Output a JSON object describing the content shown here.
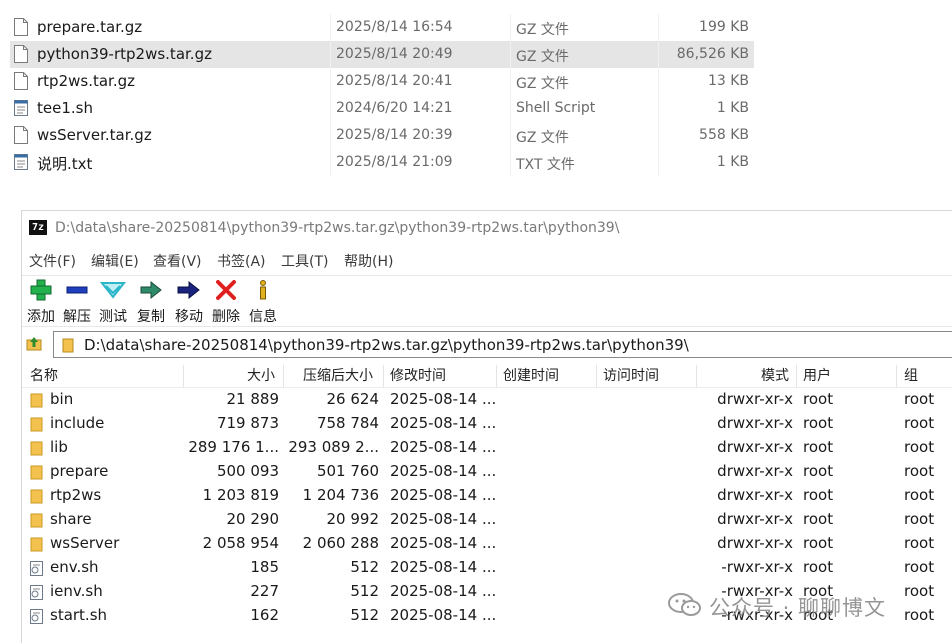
{
  "explorer": {
    "files": [
      {
        "name": "prepare.tar.gz",
        "date": "2025/8/14 16:54",
        "type": "GZ 文件",
        "size": "199 KB",
        "icon": "file-icon",
        "selected": false
      },
      {
        "name": "python39-rtp2ws.tar.gz",
        "date": "2025/8/14 20:49",
        "type": "GZ 文件",
        "size": "86,526 KB",
        "icon": "file-icon",
        "selected": true
      },
      {
        "name": "rtp2ws.tar.gz",
        "date": "2025/8/14 20:41",
        "type": "GZ 文件",
        "size": "13 KB",
        "icon": "file-icon",
        "selected": false
      },
      {
        "name": "tee1.sh",
        "date": "2024/6/20 14:21",
        "type": "Shell Script",
        "size": "1 KB",
        "icon": "script-icon",
        "selected": false
      },
      {
        "name": "wsServer.tar.gz",
        "date": "2025/8/14 20:39",
        "type": "GZ 文件",
        "size": "558 KB",
        "icon": "file-icon",
        "selected": false
      },
      {
        "name": "说明.txt",
        "date": "2025/8/14 21:09",
        "type": "TXT 文件",
        "size": "1 KB",
        "icon": "text-file-icon",
        "selected": false
      }
    ]
  },
  "window": {
    "app_icon_label": "7z",
    "title": "D:\\data\\share-20250814\\python39-rtp2ws.tar.gz\\python39-rtp2ws.tar\\python39\\",
    "menu": [
      "文件(F)",
      "编辑(E)",
      "查看(V)",
      "书签(A)",
      "工具(T)",
      "帮助(H)"
    ],
    "toolbar": [
      {
        "label": "添加",
        "icon": "add-icon",
        "color": "#22b14c"
      },
      {
        "label": "解压",
        "icon": "extract-icon",
        "color": "#1f3fbf"
      },
      {
        "label": "测试",
        "icon": "test-icon",
        "color": "#2bb5c8"
      },
      {
        "label": "复制",
        "icon": "copy-icon",
        "color": "#2f8a6a"
      },
      {
        "label": "移动",
        "icon": "move-icon",
        "color": "#1a237e"
      },
      {
        "label": "删除",
        "icon": "delete-icon",
        "color": "#e02020"
      },
      {
        "label": "信息",
        "icon": "info-icon",
        "color": "#e0b020"
      }
    ],
    "address": "D:\\data\\share-20250814\\python39-rtp2ws.tar.gz\\python39-rtp2ws.tar\\python39\\",
    "columns": [
      "名称",
      "大小",
      "压缩后大小",
      "修改时间",
      "创建时间",
      "访问时间",
      "模式",
      "用户",
      "组"
    ],
    "rows": [
      {
        "name": "bin",
        "size": "21 889",
        "packed": "26 624",
        "modified": "2025-08-14 ...",
        "mode": "drwxr-xr-x",
        "user": "root",
        "group": "root",
        "kind": "folder"
      },
      {
        "name": "include",
        "size": "719 873",
        "packed": "758 784",
        "modified": "2025-08-14 ...",
        "mode": "drwxr-xr-x",
        "user": "root",
        "group": "root",
        "kind": "folder"
      },
      {
        "name": "lib",
        "size": "289 176 1...",
        "packed": "293 089 2...",
        "modified": "2025-08-14 ...",
        "mode": "drwxr-xr-x",
        "user": "root",
        "group": "root",
        "kind": "folder"
      },
      {
        "name": "prepare",
        "size": "500 093",
        "packed": "501 760",
        "modified": "2025-08-14 ...",
        "mode": "drwxr-xr-x",
        "user": "root",
        "group": "root",
        "kind": "folder"
      },
      {
        "name": "rtp2ws",
        "size": "1 203 819",
        "packed": "1 204 736",
        "modified": "2025-08-14 ...",
        "mode": "drwxr-xr-x",
        "user": "root",
        "group": "root",
        "kind": "folder"
      },
      {
        "name": "share",
        "size": "20 290",
        "packed": "20 992",
        "modified": "2025-08-14 ...",
        "mode": "drwxr-xr-x",
        "user": "root",
        "group": "root",
        "kind": "folder"
      },
      {
        "name": "wsServer",
        "size": "2 058 954",
        "packed": "2 060 288",
        "modified": "2025-08-14 ...",
        "mode": "drwxr-xr-x",
        "user": "root",
        "group": "root",
        "kind": "folder"
      },
      {
        "name": "env.sh",
        "size": "185",
        "packed": "512",
        "modified": "2025-08-14 ...",
        "mode": "-rwxr-xr-x",
        "user": "root",
        "group": "root",
        "kind": "script"
      },
      {
        "name": "ienv.sh",
        "size": "227",
        "packed": "512",
        "modified": "2025-08-14 ...",
        "mode": "-rwxr-xr-x",
        "user": "root",
        "group": "root",
        "kind": "script"
      },
      {
        "name": "start.sh",
        "size": "162",
        "packed": "512",
        "modified": "2025-08-14 ...",
        "mode": "-rwxr-xr-x",
        "user": "root",
        "group": "root",
        "kind": "script"
      }
    ]
  },
  "watermark": {
    "text": "公众号 · 聊聊博文",
    "icon": "wechat-icon"
  }
}
